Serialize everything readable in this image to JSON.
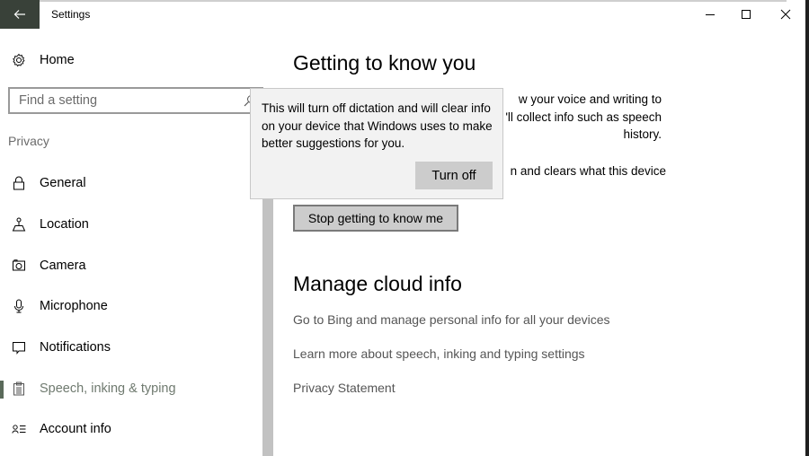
{
  "window": {
    "title": "Settings",
    "controls": {
      "minimize": "minimize",
      "maximize": "maximize",
      "close": "close"
    }
  },
  "sidebar": {
    "home_label": "Home",
    "search_placeholder": "Find a setting",
    "section_label": "Privacy",
    "items": [
      {
        "label": "General",
        "icon": "lock-icon",
        "selected": false
      },
      {
        "label": "Location",
        "icon": "location-icon",
        "selected": false
      },
      {
        "label": "Camera",
        "icon": "camera-icon",
        "selected": false
      },
      {
        "label": "Microphone",
        "icon": "microphone-icon",
        "selected": false
      },
      {
        "label": "Notifications",
        "icon": "notifications-icon",
        "selected": false
      },
      {
        "label": "Speech, inking & typing",
        "icon": "clipboard-icon",
        "selected": true
      },
      {
        "label": "Account info",
        "icon": "account-info-icon",
        "selected": false
      }
    ]
  },
  "main": {
    "section1": {
      "title": "Getting to know you",
      "para1_visible": "w your voice and writing to\n'll collect info such as speech\n history.",
      "para2_visible": "n and clears what this device",
      "button_label": "Stop getting to know me"
    },
    "section2": {
      "title": "Manage cloud info",
      "links": [
        "Go to Bing and manage personal info for all your devices",
        "Learn more about speech, inking and typing settings",
        "Privacy Statement"
      ]
    }
  },
  "flyout": {
    "message": "This will turn off dictation and will clear info on your device that Windows uses to make better suggestions for you.",
    "button_label": "Turn off"
  },
  "colors": {
    "back_button_bg": "#394139",
    "selected_indicator": "#5a6a5a",
    "button_gray": "#cccccc",
    "flyout_bg": "#f2f2f2",
    "link_text": "#555555"
  }
}
